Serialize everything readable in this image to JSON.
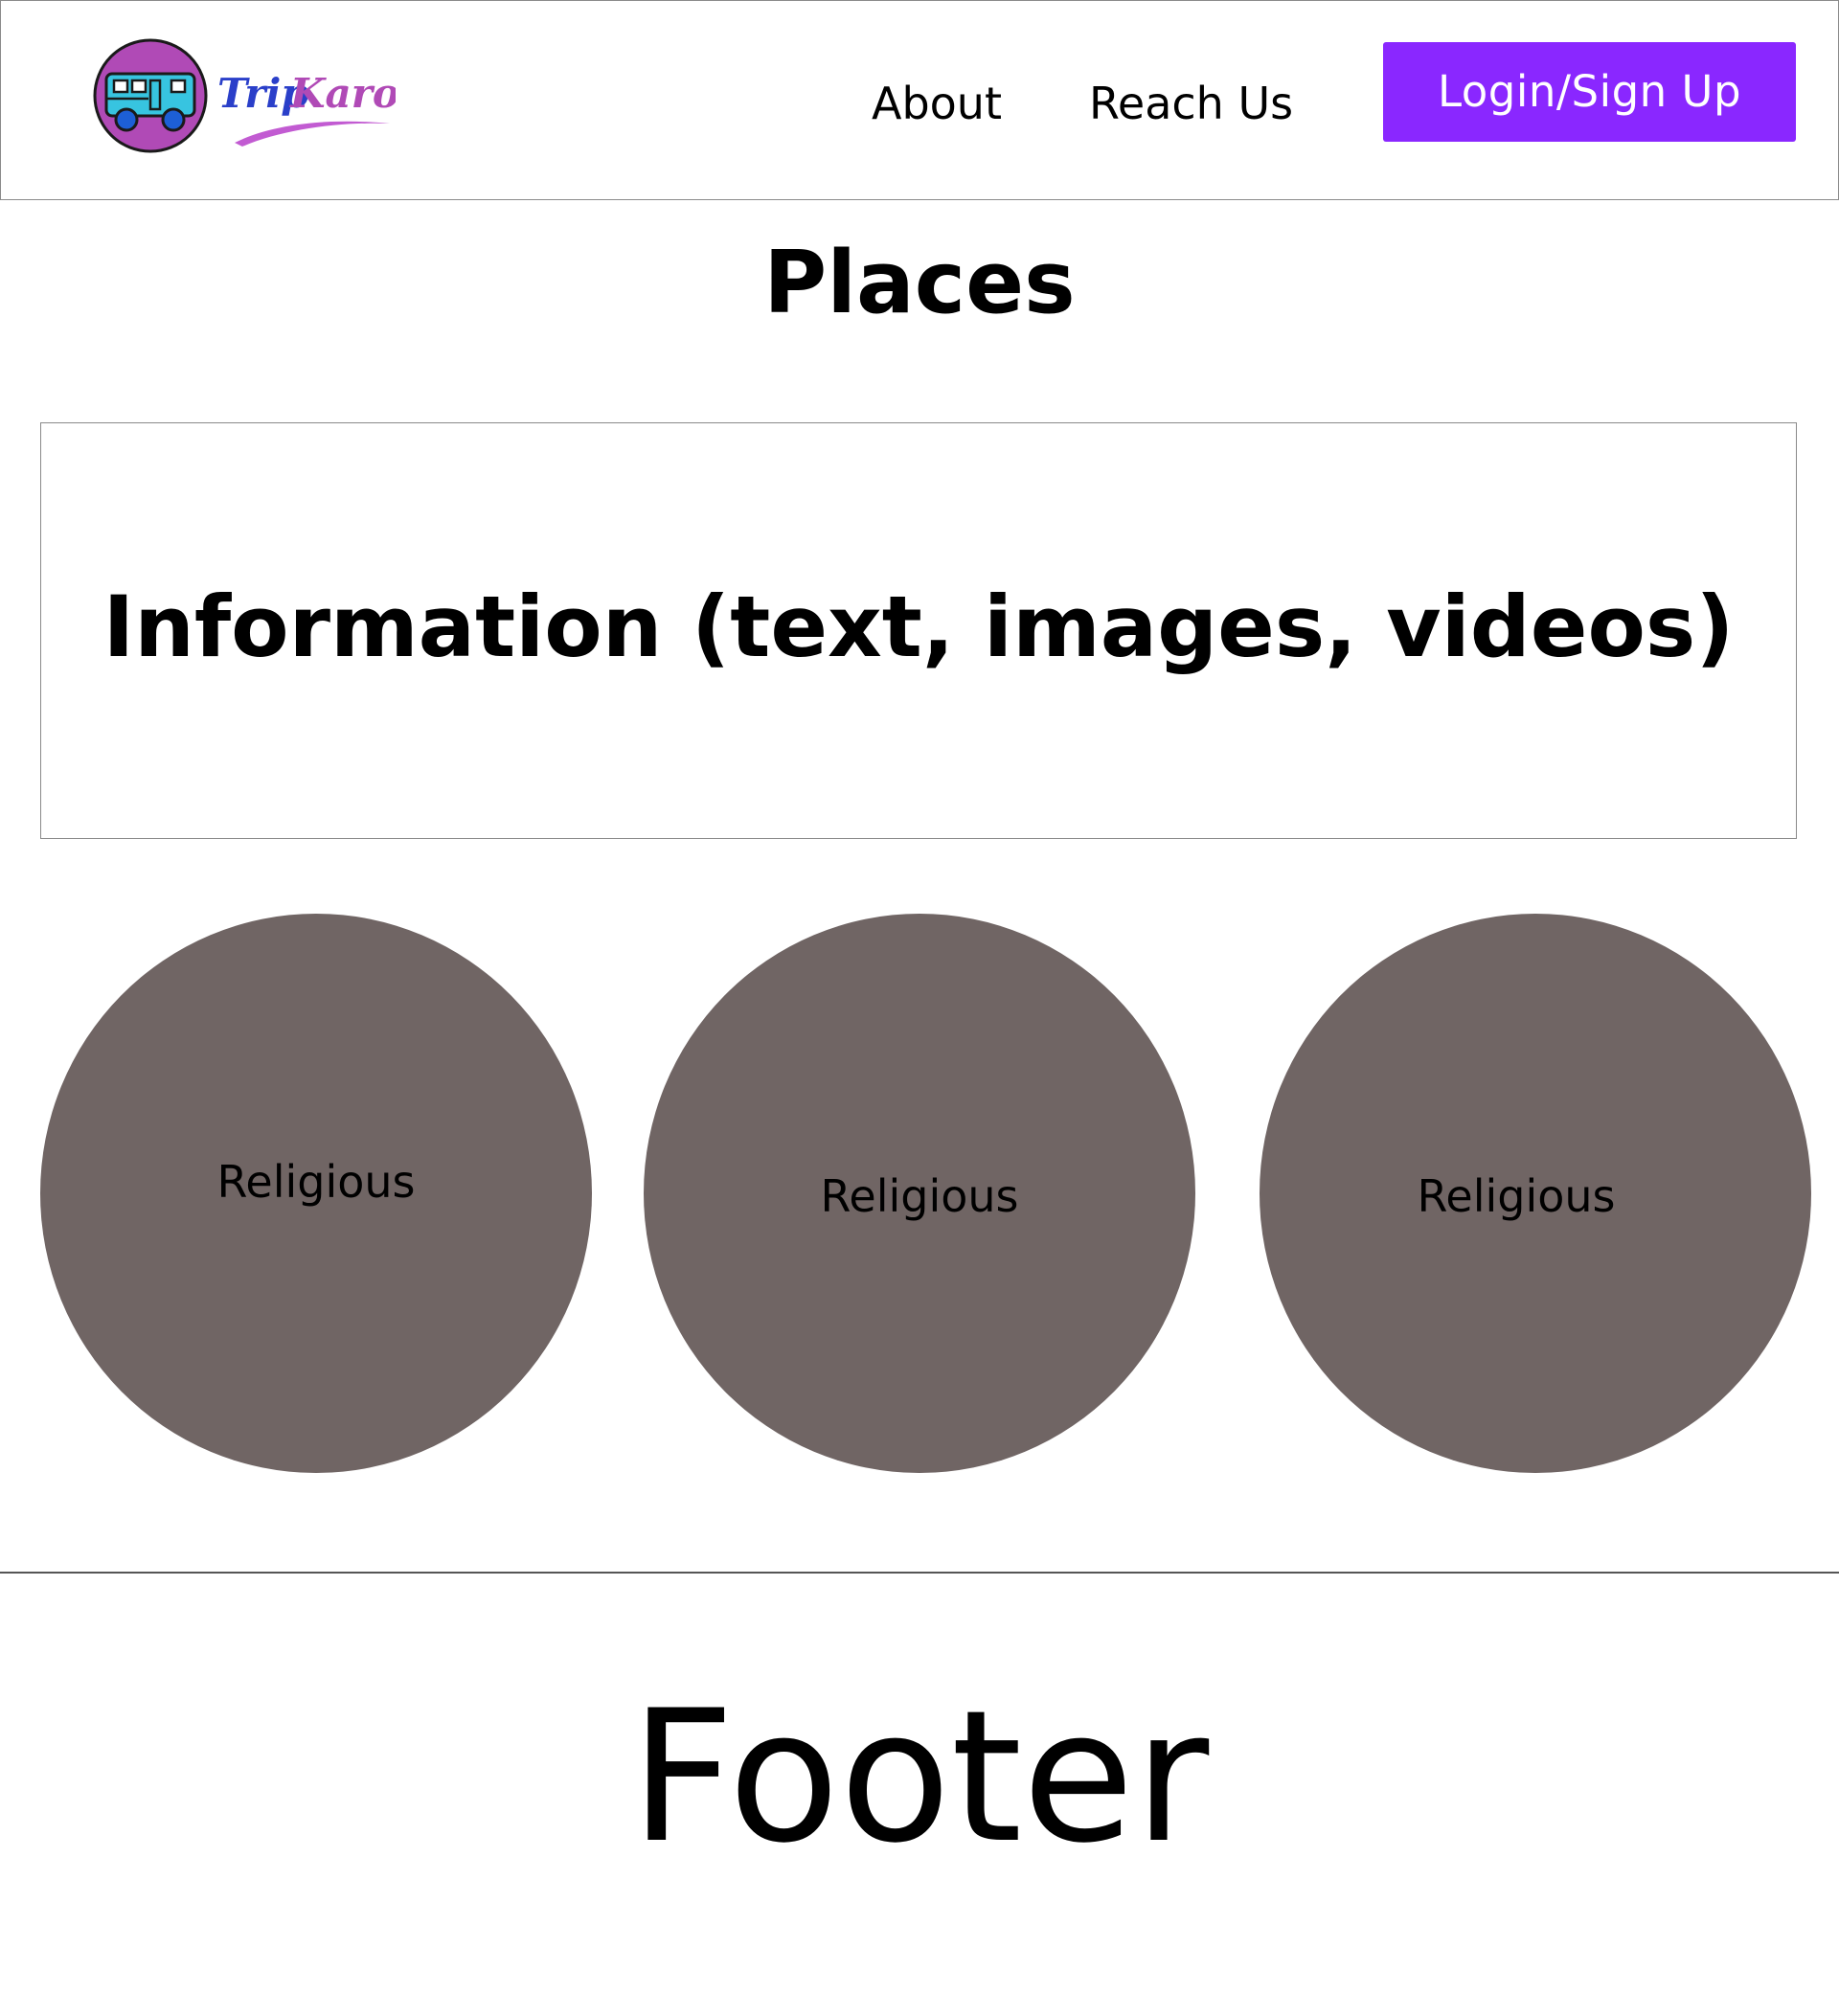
{
  "header": {
    "brand": "TripKaro",
    "nav": [
      {
        "label": "About"
      },
      {
        "label": "Reach Us"
      }
    ],
    "login_label": "Login/Sign Up"
  },
  "main": {
    "title": "Places",
    "info_text": "Information (text, images, videos)",
    "categories": [
      {
        "label": "Religious"
      },
      {
        "label": "Religious"
      },
      {
        "label": "Religious"
      }
    ]
  },
  "footer": {
    "label": "Footer"
  },
  "colors": {
    "accent": "#8a27ff",
    "category_fill": "#706564",
    "logo_circle": "#b04ab6",
    "logo_bus": "#37c4e0",
    "logo_wheels": "#1d5fd6"
  },
  "icons": {
    "logo": "bus-logo-icon"
  }
}
